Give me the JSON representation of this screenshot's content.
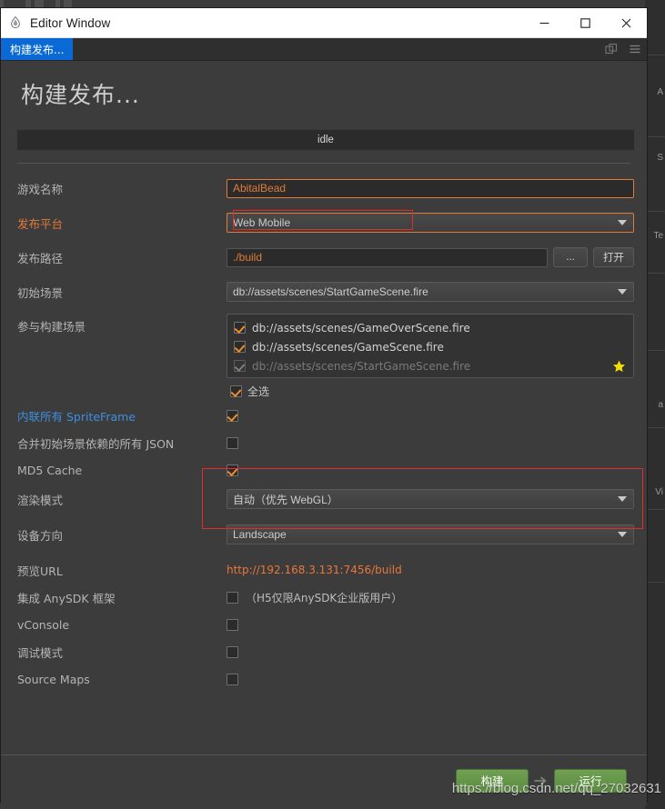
{
  "window": {
    "title": "Editor Window",
    "app_icon": "droplet-icon",
    "controls": {
      "minimize": "minimize-icon",
      "maximize": "maximize-icon",
      "close": "close-icon"
    }
  },
  "tabbar": {
    "active_tab": "构建发布...",
    "icons": [
      "popout-icon",
      "menu-icon"
    ]
  },
  "page": {
    "title": "构建发布...",
    "status": "idle"
  },
  "fields": {
    "game_name": {
      "label": "游戏名称",
      "value": "AbitalBead"
    },
    "platform": {
      "label": "发布平台",
      "value": "Web Mobile",
      "highlighted": true
    },
    "build_path": {
      "label": "发布路径",
      "value": "./build",
      "browse_label": "...",
      "open_label": "打开"
    },
    "start_scene": {
      "label": "初始场景",
      "value": "db://assets/scenes/StartGameScene.fire"
    },
    "scenes": {
      "label": "参与构建场景",
      "items": [
        {
          "path": "db://assets/scenes/GameOverScene.fire",
          "checked": true,
          "disabled": false,
          "starred": false
        },
        {
          "path": "db://assets/scenes/GameScene.fire",
          "checked": true,
          "disabled": false,
          "starred": false
        },
        {
          "path": "db://assets/scenes/StartGameScene.fire",
          "checked": true,
          "disabled": true,
          "starred": true
        }
      ],
      "select_all_label": "全选",
      "select_all_checked": true
    },
    "inline_spriteframe": {
      "label": "内联所有 SpriteFrame",
      "checked": true
    },
    "merge_json": {
      "label": "合并初始场景依赖的所有 JSON",
      "checked": false
    },
    "md5_cache": {
      "label": "MD5 Cache",
      "checked": true
    },
    "render_mode": {
      "label": "渲染模式",
      "value": "自动（优先 WebGL）"
    },
    "device_orientation": {
      "label": "设备方向",
      "value": "Landscape",
      "highlighted": true
    },
    "preview_url": {
      "label": "预览URL",
      "value": "http://192.168.3.131:7456/build"
    },
    "anysdk": {
      "label": "集成 AnySDK 框架",
      "checked": false,
      "note": "（H5仅限AnySDK企业版用户）"
    },
    "vconsole": {
      "label": "vConsole",
      "checked": false
    },
    "debug_mode": {
      "label": "调试模式",
      "checked": false
    },
    "source_maps": {
      "label": "Source Maps",
      "checked": false
    }
  },
  "footer": {
    "build_label": "构建",
    "run_label": "运行",
    "arrow_icon": "arrow-right-icon"
  },
  "watermark": "https://blog.csdn.net/qq_27032631",
  "colors": {
    "accent_orange": "#e07b39",
    "link_blue": "#3e8ede",
    "tab_blue": "#0a69d4",
    "annotation_red": "#e22c2c",
    "button_green": "#5d8c42",
    "star_yellow": "#f5e000"
  },
  "background_ghost_texts": [
    "A",
    "S",
    "Te",
    "a",
    "Vi"
  ]
}
